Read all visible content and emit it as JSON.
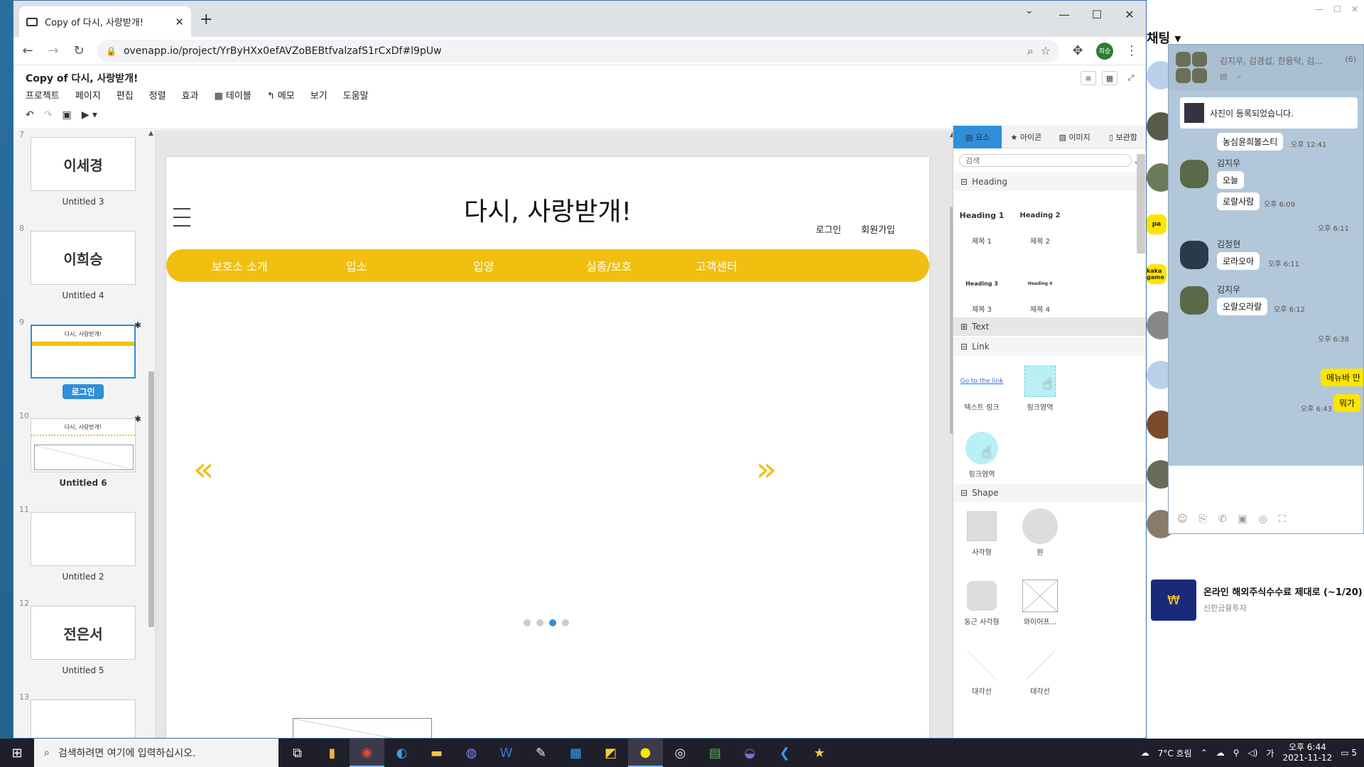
{
  "browser": {
    "tab_title": "Copy of 다시, 사랑받개!",
    "url": "ovenapp.io/project/YrByHXx0efAVZoBEBtfvalzafS1rCxDf#l9pUw",
    "profile_initials": "희승"
  },
  "app": {
    "doc_title": "Copy of 다시, 사랑받개!",
    "menu": [
      "프로젝트",
      "페이지",
      "편집",
      "정렬",
      "효과",
      "테이블",
      "메모",
      "보기",
      "도움말"
    ]
  },
  "pages": [
    {
      "num": "7",
      "thumb_text": "이세경",
      "label": "Untitled 3"
    },
    {
      "num": "8",
      "thumb_text": "이희승",
      "label": "Untitled 4"
    },
    {
      "num": "9",
      "thumb_text": "다시, 사랑받개!",
      "label": "로그인"
    },
    {
      "num": "10",
      "thumb_text": "다시, 사랑받개!",
      "label": "Untitled 6"
    },
    {
      "num": "11",
      "thumb_text": "",
      "label": "Untitled 2"
    },
    {
      "num": "12",
      "thumb_text": "전은서",
      "label": "Untitled 5"
    },
    {
      "num": "13",
      "thumb_text": "",
      "label": ""
    }
  ],
  "canvas": {
    "site_title": "다시, 사랑받개!",
    "login": "로그인",
    "signup": "회원가입",
    "nav": [
      "보호소 소개",
      "입소",
      "입양",
      "실종/보호",
      "고객센터"
    ],
    "prev_arrow": "«",
    "next_arrow": "»",
    "active_dot": 3,
    "dot_count": 4,
    "accent_color": "#f0bf10"
  },
  "elements_panel": {
    "tabs": [
      "요소",
      "아이콘",
      "이미지",
      "보관함"
    ],
    "search_placeholder": "검색",
    "sections": {
      "heading": "Heading",
      "text": "Text",
      "link": "Link",
      "shape": "Shape"
    },
    "heading_items": [
      {
        "preview": "Heading 1",
        "caption": "제목 1"
      },
      {
        "preview": "Heading 2",
        "caption": "제목 2"
      },
      {
        "preview": "Heading 3",
        "caption": "제목 3"
      },
      {
        "preview": "Heading 4",
        "caption": "제목 4"
      }
    ],
    "link_items": [
      {
        "preview": "Go to the link",
        "caption": "텍스트 링크"
      },
      {
        "preview": "",
        "caption": "링크영역"
      },
      {
        "preview": "",
        "caption": "링크영역"
      }
    ],
    "shape_items": [
      "사각형",
      "원",
      "둥근 사각형",
      "와이어프...",
      "대각선",
      "대각선"
    ]
  },
  "kakao": {
    "header": "채팅",
    "chat_names": "김지우, 김경섭, 한용탁, 김...",
    "member_count": "(6)",
    "photo_notice": "사진이 등록되었습니다.",
    "messages": [
      {
        "name": "",
        "text": "농심윤희볼스티",
        "time": "오후 12:41"
      },
      {
        "name": "김지우",
        "text": "오늘",
        "time": ""
      },
      {
        "name": "",
        "text": "로랄사람",
        "time": "오후 6:09"
      },
      {
        "name": "",
        "text": "",
        "time": "오후 6:11"
      },
      {
        "name": "김정현",
        "text": "로라오아",
        "time": "오후 6:11"
      },
      {
        "name": "김지우",
        "text": "오랄오라랄",
        "time": "오후 6:12"
      },
      {
        "name": "",
        "text": "",
        "time": "오후 6:38"
      },
      {
        "name": "",
        "text": "메뉴바 만",
        "time": ""
      },
      {
        "name": "",
        "text": "뭐가",
        "time": "오후 6:43"
      }
    ],
    "ad_title": "온라인 해외주식수수료 제대로 (~1/20)",
    "ad_sub": "신한금융투자",
    "side_labels": [
      "pa",
      "kaka game"
    ]
  },
  "taskbar": {
    "search_placeholder": "검색하려면 여기에 입력하십시오.",
    "weather": "7°C 흐림",
    "time": "오후 6:44",
    "date": "2021-11-12",
    "notif_count": "5"
  }
}
